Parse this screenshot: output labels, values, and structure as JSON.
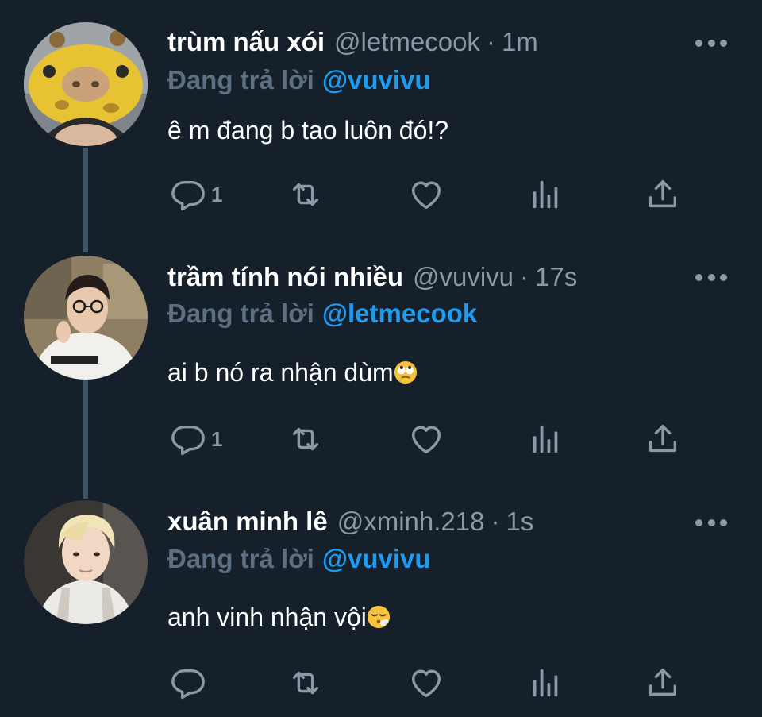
{
  "tweets": [
    {
      "display_name": "trùm nấu xói",
      "handle": "@letmecook",
      "time": "1m",
      "reply_prefix": "Đang trả lời",
      "reply_handle": "@vuvivu",
      "text": "ê m đang b tao luôn đó!?",
      "emoji": "",
      "reply_count": "1",
      "avatar_desc": "avatar-giraffe-hat"
    },
    {
      "display_name": "trầm tính nói nhiều",
      "handle": "@vuvivu",
      "time": "17s",
      "reply_prefix": "Đang trả lời",
      "reply_handle": "@letmecook",
      "text": "ai b nó ra nhận dùm",
      "emoji": "face-with-rolling-eyes",
      "reply_count": "1",
      "avatar_desc": "avatar-glasses"
    },
    {
      "display_name": "xuân minh lê",
      "handle": "@xminh.218",
      "time": "1s",
      "reply_prefix": "Đang trả lời",
      "reply_handle": "@vuvivu",
      "text": "anh vinh nhận vội",
      "emoji": "face-exhaling",
      "reply_count": "",
      "avatar_desc": "avatar-blonde"
    }
  ],
  "icons": {
    "reply": "reply-icon",
    "retweet": "retweet-icon",
    "like": "heart-icon",
    "views": "views-icon",
    "share": "share-icon",
    "more": "more-icon"
  },
  "colors": {
    "background": "#15202b",
    "secondary_text": "#8b98a5",
    "accent": "#1d9bf0",
    "thread_line": "#3d5466"
  }
}
